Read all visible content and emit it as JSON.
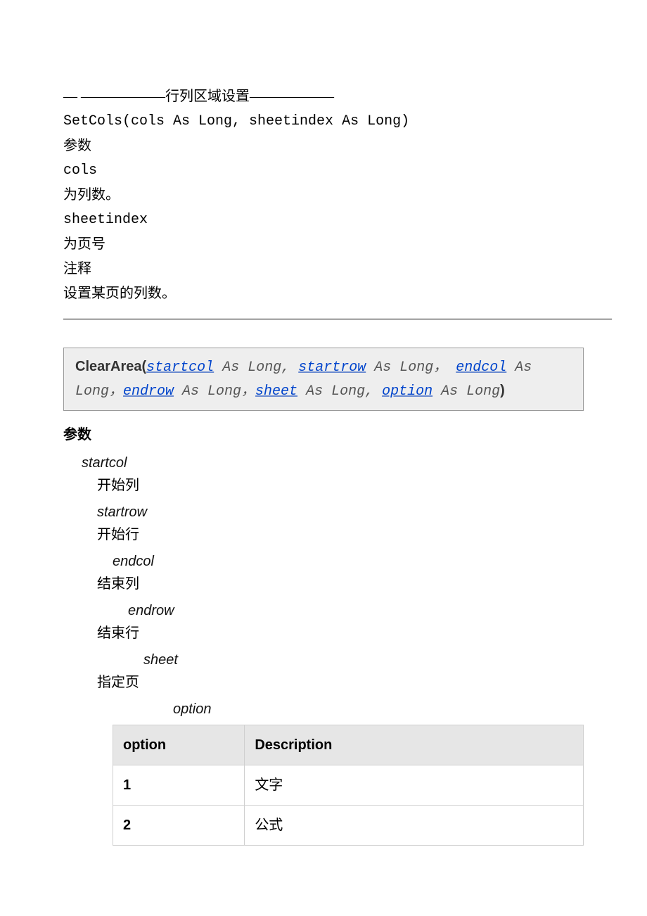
{
  "intro": {
    "header_line": "— ——————行列区域设置——————",
    "signature": "SetCols(cols As Long, sheetindex As Long)",
    "params_label": "参数",
    "p1_name": "cols",
    "p1_desc": "为列数。",
    "p2_name": "sheetindex",
    "p2_desc": "为页号",
    "notes_label": "注释",
    "notes_text": "设置某页的列数。",
    "divider": "———————————————————————————————————————"
  },
  "code": {
    "fn": "ClearArea(",
    "a1": "startcol",
    "t1": " As Long, ",
    "a2": "startrow",
    "t2": " As Long，",
    "a3": "endcol",
    "t3": " As Long，",
    "a4": "endrow",
    "t4": " As Long，",
    "a5": "sheet",
    "t5": " As Long, ",
    "a6": "option",
    "t6": " As Long",
    "close": ")"
  },
  "params": {
    "heading": "参数",
    "items": [
      {
        "name": "startcol",
        "desc": "开始列"
      },
      {
        "name": "startrow",
        "desc": "开始行"
      },
      {
        "name": "endcol",
        "desc": "结束列"
      },
      {
        "name": "endrow",
        "desc": "结束行"
      },
      {
        "name": "sheet",
        "desc": "指定页"
      },
      {
        "name": "option",
        "desc": ""
      }
    ]
  },
  "table": {
    "headers": {
      "c1": "option",
      "c2": "Description"
    },
    "rows": [
      {
        "k": "1",
        "v": "文字"
      },
      {
        "k": "2",
        "v": "公式"
      }
    ]
  }
}
